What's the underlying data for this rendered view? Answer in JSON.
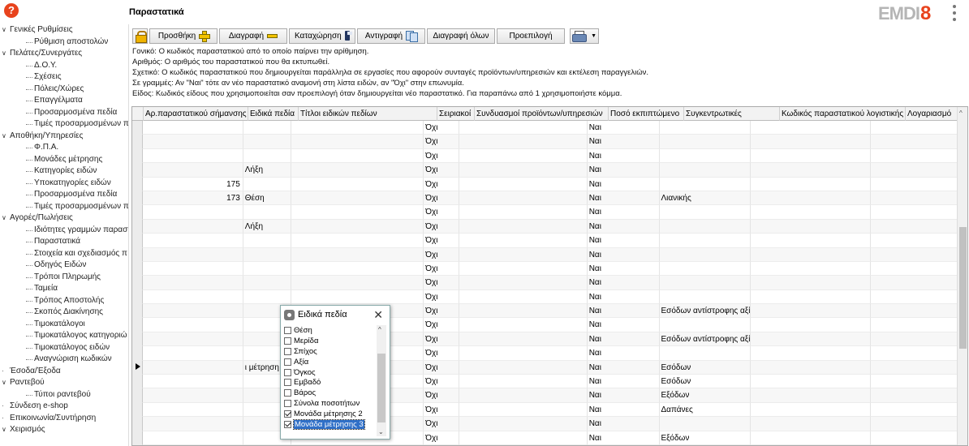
{
  "header": {
    "title": "Παραστατικά",
    "logo_text": "EMDI",
    "logo_digit": "8"
  },
  "sidebar": {
    "items": [
      {
        "label": "Γενικές Ρυθμίσεις",
        "level": 0,
        "expanded": true
      },
      {
        "label": "Ρύθμιση αποστολών",
        "level": 1
      },
      {
        "label": "Πελάτες/Συνεργάτες",
        "level": 0,
        "expanded": true
      },
      {
        "label": "Δ.Ο.Υ.",
        "level": 1
      },
      {
        "label": "Σχέσεις",
        "level": 1
      },
      {
        "label": "Πόλεις/Χώρες",
        "level": 1
      },
      {
        "label": "Επαγγέλματα",
        "level": 1
      },
      {
        "label": "Προσαρμοσμένα πεδία",
        "level": 1
      },
      {
        "label": "Τιμές προσαρμοσμένων π",
        "level": 1
      },
      {
        "label": "Αποθήκη/Υπηρεσίες",
        "level": 0,
        "expanded": true
      },
      {
        "label": "Φ.Π.Α.",
        "level": 1
      },
      {
        "label": "Μονάδες μέτρησης",
        "level": 1
      },
      {
        "label": "Κατηγορίες ειδών",
        "level": 1
      },
      {
        "label": "Υποκατηγορίες ειδών",
        "level": 1
      },
      {
        "label": "Προσαρμοσμένα πεδία",
        "level": 1
      },
      {
        "label": "Τιμές προσαρμοσμένων π",
        "level": 1
      },
      {
        "label": "Αγορές/Πωλήσεις",
        "level": 0,
        "expanded": true
      },
      {
        "label": "Ιδιότητες γραμμών παραστ",
        "level": 1
      },
      {
        "label": "Παραστατικά",
        "level": 1
      },
      {
        "label": "Στοιχεία και σχεδιασμός π",
        "level": 1
      },
      {
        "label": "Οδηγός Ειδών",
        "level": 1
      },
      {
        "label": "Τρόποι Πληρωμής",
        "level": 1
      },
      {
        "label": "Ταμεία",
        "level": 1
      },
      {
        "label": "Τρόπος Αποστολής",
        "level": 1
      },
      {
        "label": "Σκοπός Διακίνησης",
        "level": 1
      },
      {
        "label": "Τιμοκατάλογοι",
        "level": 1
      },
      {
        "label": "Τιμοκατάλογος κατηγοριώ",
        "level": 1
      },
      {
        "label": "Τιμοκατάλογος ειδών",
        "level": 1
      },
      {
        "label": "Αναγνώριση κωδικών",
        "level": 1
      },
      {
        "label": "Έσοδα/Έξοδα",
        "level": 0,
        "expanded": false
      },
      {
        "label": "Ραντεβού",
        "level": 0,
        "expanded": true
      },
      {
        "label": "Τύποι ραντεβού",
        "level": 1
      },
      {
        "label": "Σύνδεση e-shop",
        "level": 0,
        "expanded": false
      },
      {
        "label": "Επικοινωνία/Συντήρηση",
        "level": 0,
        "expanded": false
      },
      {
        "label": "Χειρισμός",
        "level": 0,
        "expanded": true
      }
    ]
  },
  "toolbar": {
    "add": "Προσθήκη",
    "delete": "Διαγραφή",
    "save": "Καταχώρηση",
    "copy": "Αντιγραφή",
    "delete_all": "Διαγραφή όλων",
    "default": "Προεπιλογή"
  },
  "info_lines": [
    "Γονικό: Ο κωδικός παραστατικού από το οποίο παίρνει την αρίθμηση.",
    "Αριθμός: Ο αριθμός του παραστατικού που θα εκτυπωθεί.",
    "Σχετικό: Ο κωδικός παραστατικού που δημιουργείται παράλληλα σε εργασίες που αφορούν συνταγές προϊόντων/υπηρεσιών και εκτέλεση παραγγελιών.",
    "Σε γραμμές: Αν \"Ναι\" τότε αν νέο παραστατικό αναμονή στη λίστα ειδών, αν \"Όχι\" στην επωνυμία.",
    "Είδος: Κωδικός είδους που χρησιμοποιείται σαν προεπιλογή όταν δημιουργείται νέο παραστατικό. Για παραπάνω από 1 χρησιμοποιήστε κόμμα."
  ],
  "grid": {
    "columns": [
      "Αρ.παραστατικού σήμανσης",
      "Ειδικά πεδία",
      "Τίτλοι ειδικών πεδίων",
      "Σειριακοί",
      "Συνδυασμοί προϊόντων/υπηρεσιών",
      "Ποσό εκπιπτώμενο",
      "Συγκεντρωτικές",
      "Κωδικός παραστατικού λογιστικής",
      "Λογαριασμό"
    ],
    "rows": [
      [
        "",
        "",
        "",
        "Όχι",
        "",
        "Ναι",
        "",
        "",
        ""
      ],
      [
        "",
        "",
        "",
        "Όχι",
        "",
        "Ναι",
        "",
        "",
        ""
      ],
      [
        "",
        "",
        "",
        "Όχι",
        "",
        "Ναι",
        "",
        "",
        ""
      ],
      [
        "",
        "Λήξη",
        "",
        "Όχι",
        "",
        "Ναι",
        "",
        "",
        ""
      ],
      [
        "175",
        "",
        "",
        "Όχι",
        "",
        "Ναι",
        "",
        "",
        ""
      ],
      [
        "173",
        "Θέση",
        "",
        "Όχι",
        "",
        "Ναι",
        "Λιανικής",
        "",
        ""
      ],
      [
        "",
        "",
        "",
        "Όχι",
        "",
        "Ναι",
        "",
        "",
        ""
      ],
      [
        "",
        "Λήξη",
        "",
        "Όχι",
        "",
        "Ναι",
        "",
        "",
        ""
      ],
      [
        "",
        "",
        "",
        "Όχι",
        "",
        "Ναι",
        "",
        "",
        ""
      ],
      [
        "",
        "",
        "",
        "Όχι",
        "",
        "Ναι",
        "",
        "",
        ""
      ],
      [
        "",
        "",
        "",
        "Όχι",
        "",
        "Ναι",
        "",
        "",
        ""
      ],
      [
        "",
        "",
        "",
        "Όχι",
        "",
        "Ναι",
        "",
        "",
        ""
      ],
      [
        "",
        "",
        "",
        "Όχι",
        "",
        "Ναι",
        "",
        "",
        ""
      ],
      [
        "",
        "",
        "",
        "Όχι",
        "",
        "Ναι",
        "Εσόδων αντίστροφης αξί",
        "",
        ""
      ],
      [
        "",
        "",
        "",
        "Όχι",
        "",
        "Ναι",
        "",
        "",
        ""
      ],
      [
        "",
        "",
        "",
        "Όχι",
        "",
        "Ναι",
        "Εσόδων αντίστροφης αξί",
        "",
        ""
      ],
      [
        "",
        "",
        "",
        "Όχι",
        "",
        "Ναι",
        "",
        "",
        ""
      ],
      [
        "",
        "ι μέτρηση",
        "",
        "Όχι",
        "",
        "Ναι",
        "Εσόδων",
        "",
        ""
      ],
      [
        "",
        "",
        "",
        "Όχι",
        "",
        "Ναι",
        "Εσόδων",
        "",
        ""
      ],
      [
        "",
        "",
        "",
        "Όχι",
        "",
        "Ναι",
        "Εξόδων",
        "",
        ""
      ],
      [
        "",
        "",
        "",
        "Όχι",
        "",
        "Ναι",
        "Δαπάνες",
        "",
        ""
      ],
      [
        "",
        "",
        "",
        "Όχι",
        "",
        "Ναι",
        "",
        "",
        ""
      ],
      [
        "",
        "",
        "",
        "Όχι",
        "",
        "Ναι",
        "Εξόδων",
        "",
        ""
      ]
    ],
    "current_row": 17
  },
  "popup": {
    "title": "Ειδικά πεδία",
    "items": [
      {
        "label": "Θέση",
        "checked": false
      },
      {
        "label": "Μερίδα",
        "checked": false
      },
      {
        "label": "Σπίχος",
        "checked": false
      },
      {
        "label": "Αξία",
        "checked": false
      },
      {
        "label": "Όγκος",
        "checked": false
      },
      {
        "label": "Εμβαδό",
        "checked": false
      },
      {
        "label": "Βάρος",
        "checked": false
      },
      {
        "label": "Σύνολα ποσοτήτων",
        "checked": false
      },
      {
        "label": "Μονάδα μέτρησης 2",
        "checked": true
      },
      {
        "label": "Μονάδα μέτρησης 3",
        "checked": true,
        "selected": true
      }
    ]
  },
  "colors": {
    "accent": "#e8431d",
    "selection": "#3070c8",
    "logo_gray": "#b5b5b5"
  }
}
